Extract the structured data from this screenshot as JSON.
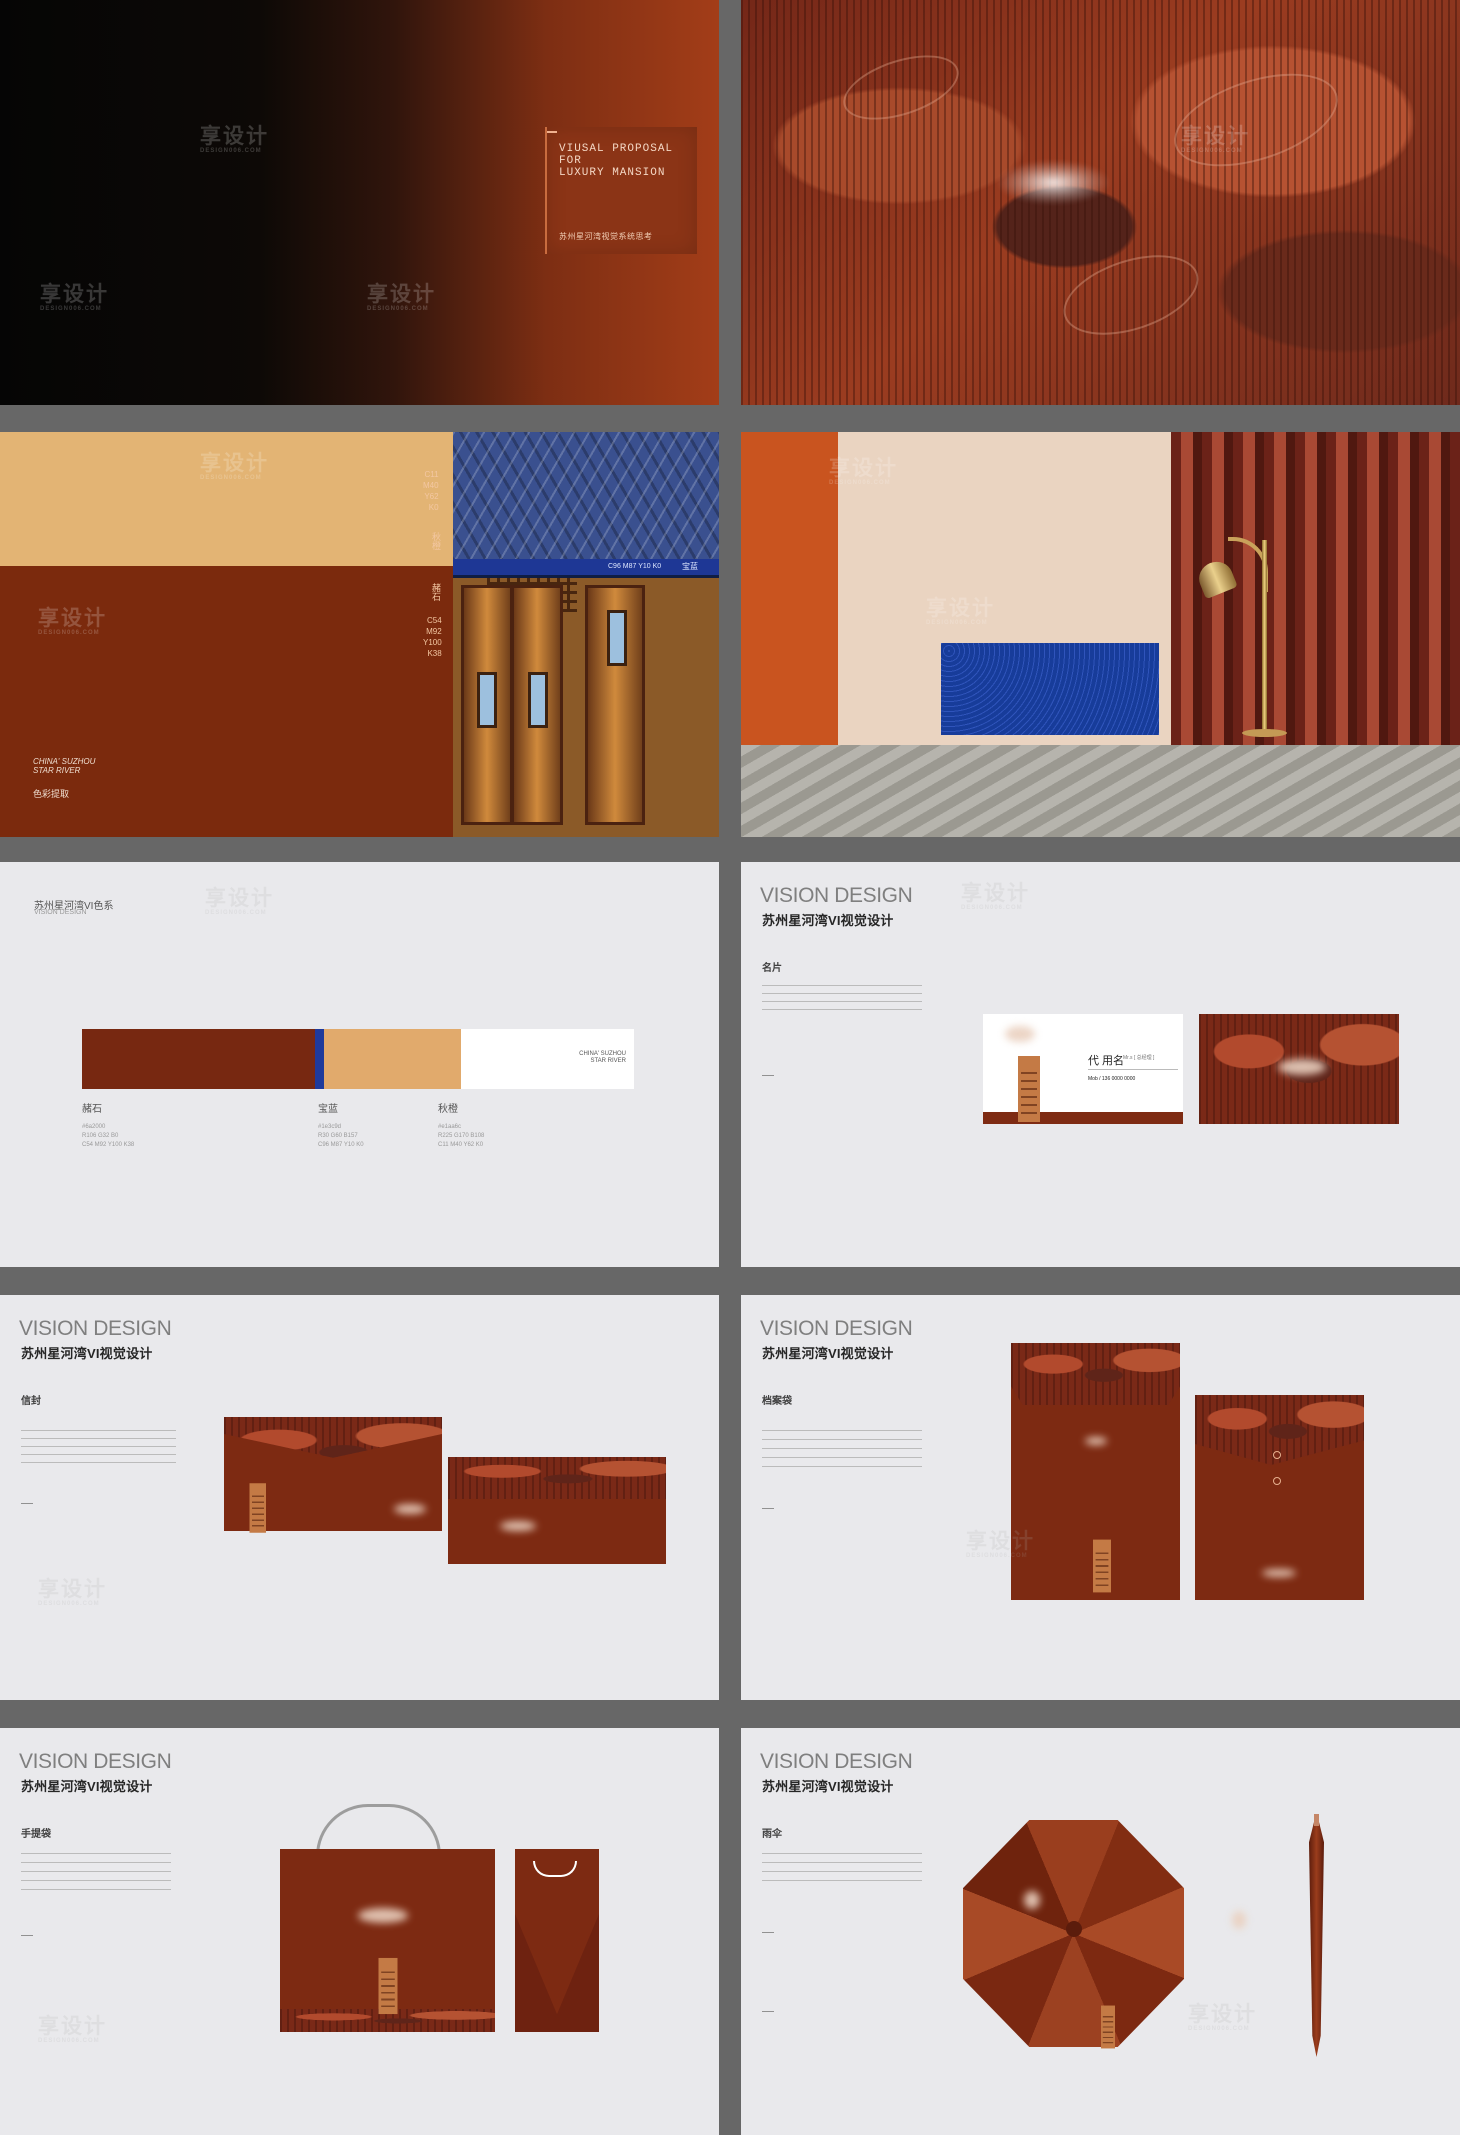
{
  "cover": {
    "title": "VIUSAL PROPOSAL\nFOR\nLUXURY MANSION",
    "subtitle": "苏州星河湾视觉系统思考"
  },
  "color_page": {
    "top_codes": "C11\nM40\nY62\nK0",
    "top_name": "秋橙",
    "mid_name": "赭石",
    "mid_codes": "C54\nM92\nY100\nK38",
    "blue_codes": "C96  M87  Y10  K0",
    "blue_name": "宝蓝",
    "foot_en": "CHINA' SUZHOU\nSTAR RIVER",
    "foot_cn": "色彩提取"
  },
  "palette_page": {
    "title": "苏州星河湾VI色系",
    "subtitle": "VISION DESIGN",
    "badge": "CHINA' SUZHOU\nSTAR RIVER",
    "swatches": [
      {
        "name": "赭石",
        "hex": "#6a2000",
        "lines": "#6a2000\nR106  G32  B0\nC54  M92  Y100  K38",
        "color": "#772811"
      },
      {
        "name": "宝蓝",
        "hex": "#1e3c9d",
        "lines": "#1e3c9d\nR30  G60  B157\nC96  M87  Y10  K0",
        "color": "#1f3a9b"
      },
      {
        "name": "秋橙",
        "hex": "#e1aa6c",
        "lines": "#e1aa6c\nR225  G170  B108\nC11  M40  Y62  K0",
        "color": "#e1aa6c"
      }
    ]
  },
  "vision": {
    "title": "VISION DESIGN",
    "cn": "苏州星河湾VI视觉设计"
  },
  "sections": {
    "card": "名片",
    "envelope": "信封",
    "archive": "档案袋",
    "bag": "手提袋",
    "umbrella": "雨伞"
  },
  "business_card": {
    "name": "代 用名",
    "role": "Mr.s [ 总经理 ]",
    "contact": "Mob / 136 0000 0000"
  },
  "watermark": {
    "main": "享设计",
    "sub": "DESIGN006.COM"
  },
  "colors": {
    "ochre": "#7b2a0d",
    "blue": "#1e3c9d",
    "orange": "#e1aa6c",
    "background": "#e9e9ec"
  }
}
